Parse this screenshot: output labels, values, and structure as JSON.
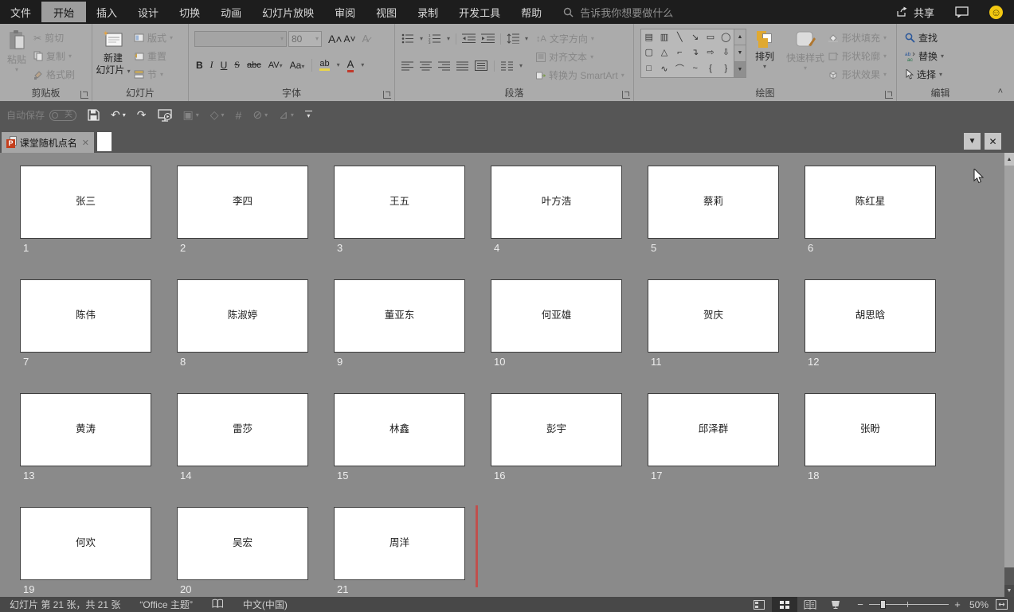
{
  "titlebar": {
    "tabs": [
      {
        "label": "文件",
        "active": false
      },
      {
        "label": "开始",
        "active": true
      },
      {
        "label": "插入",
        "active": false
      },
      {
        "label": "设计",
        "active": false
      },
      {
        "label": "切换",
        "active": false
      },
      {
        "label": "动画",
        "active": false
      },
      {
        "label": "幻灯片放映",
        "active": false
      },
      {
        "label": "审阅",
        "active": false
      },
      {
        "label": "视图",
        "active": false
      },
      {
        "label": "录制",
        "active": false
      },
      {
        "label": "开发工具",
        "active": false
      },
      {
        "label": "帮助",
        "active": false
      }
    ],
    "search_placeholder": "告诉我你想要做什么",
    "share_label": "共享"
  },
  "qat": {
    "autosave_label": "自动保存",
    "autosave_state": "关"
  },
  "ribbon": {
    "clipboard": {
      "label": "剪贴板",
      "paste": "粘贴",
      "cut": "剪切",
      "copy": "复制",
      "format_painter": "格式刷"
    },
    "slides_group": {
      "label": "幻灯片",
      "new_slide_1": "新建",
      "new_slide_2": "幻灯片",
      "layout": "版式",
      "reset": "重置",
      "section": "节"
    },
    "font_group": {
      "label": "字体",
      "font_size": "80",
      "bold": "B",
      "italic": "I",
      "underline": "U",
      "strikethrough": "S",
      "clear_abc": "abc",
      "char_spacing": "AV",
      "change_case": "Aa",
      "highlight": "ab",
      "font_color": "A"
    },
    "paragraph_group": {
      "label": "段落",
      "text_direction": "文字方向",
      "align_text": "对齐文本",
      "smartart": "转换为 SmartArt"
    },
    "drawing_group": {
      "label": "绘图",
      "arrange": "排列",
      "quick_styles": "快速样式",
      "shape_fill": "形状填充",
      "shape_outline": "形状轮廓",
      "shape_effects": "形状效果",
      "shape_glyphs": [
        "▤",
        "▥",
        "╲",
        "↘",
        "▭",
        "◯",
        "▢",
        "△",
        "⌐",
        "↴",
        "⇨",
        "⇩",
        "□",
        "∿",
        "⌒",
        "~",
        "{",
        "}"
      ]
    },
    "editing_group": {
      "label": "编辑",
      "find": "查找",
      "replace": "替换",
      "select": "选择"
    }
  },
  "document_tab": {
    "title": "课堂随机点名"
  },
  "slides": [
    {
      "num": 1,
      "name": "张三"
    },
    {
      "num": 2,
      "name": "李四"
    },
    {
      "num": 3,
      "name": "王五"
    },
    {
      "num": 4,
      "name": "叶方浩"
    },
    {
      "num": 5,
      "name": "蔡莉"
    },
    {
      "num": 6,
      "name": "陈红星"
    },
    {
      "num": 7,
      "name": "陈伟"
    },
    {
      "num": 8,
      "name": "陈淑婷"
    },
    {
      "num": 9,
      "name": "董亚东"
    },
    {
      "num": 10,
      "name": "何亚雄"
    },
    {
      "num": 11,
      "name": "贺庆"
    },
    {
      "num": 12,
      "name": "胡思晗"
    },
    {
      "num": 13,
      "name": "黄涛"
    },
    {
      "num": 14,
      "name": "雷莎"
    },
    {
      "num": 15,
      "name": "林鑫"
    },
    {
      "num": 16,
      "name": "彭宇"
    },
    {
      "num": 17,
      "name": "邱泽群"
    },
    {
      "num": 18,
      "name": "张盼"
    },
    {
      "num": 19,
      "name": "何欢"
    },
    {
      "num": 20,
      "name": "吴宏"
    },
    {
      "num": 21,
      "name": "周洋"
    }
  ],
  "insertion_marker_after_slide": 21,
  "status_bar": {
    "slide_counter": "幻灯片 第 21 张，共 21 张",
    "theme": "“Office 主题”",
    "language": "中文(中国)",
    "zoom_level": "50%"
  },
  "colors": {
    "ppt_red": "#C43E1C",
    "insertion_line": "#C0504D",
    "smiley_yellow": "#F2C811",
    "ribbon_bg": "#ABABAB",
    "canvas_bg": "#8A8A8A"
  }
}
